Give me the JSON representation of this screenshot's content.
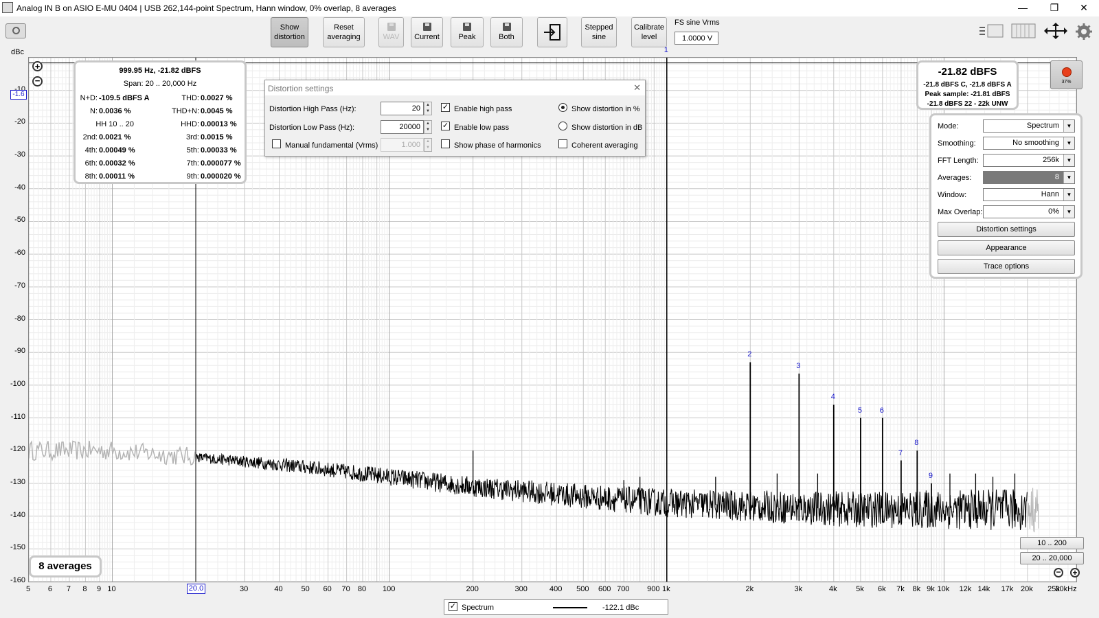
{
  "window": {
    "title": "Analog IN B on ASIO E-MU 0404 | USB 262,144-point Spectrum, Hann window, 0% overlap, 8 averages",
    "minimize": "—",
    "maximize": "❐",
    "close": "✕"
  },
  "toolbar": {
    "show_distortion": [
      "Show",
      "distortion"
    ],
    "reset_averaging": [
      "Reset",
      "averaging"
    ],
    "wav": "WAV",
    "current": "Current",
    "peak": "Peak",
    "both": "Both",
    "stepped_sine": [
      "Stepped",
      "sine"
    ],
    "calibrate_level": [
      "Calibrate",
      "level"
    ],
    "fs_sine_label": "FS sine Vrms",
    "fs_sine_value": "1.0000 V"
  },
  "yaxis": {
    "unit": "dBc",
    "cursor_value": "-1.6",
    "unit_select": "dBc",
    "ticks": [
      "-10",
      "-20",
      "-30",
      "-40",
      "-50",
      "-60",
      "-70",
      "-80",
      "-90",
      "-100",
      "-110",
      "-120",
      "-130",
      "-140",
      "-150",
      "-160"
    ]
  },
  "xaxis": {
    "ticks": [
      {
        "f": 5,
        "l": "5"
      },
      {
        "f": 6,
        "l": "6"
      },
      {
        "f": 7,
        "l": "7"
      },
      {
        "f": 8,
        "l": "8"
      },
      {
        "f": 9,
        "l": "9"
      },
      {
        "f": 10,
        "l": "10"
      },
      {
        "f": 30,
        "l": "30"
      },
      {
        "f": 40,
        "l": "40"
      },
      {
        "f": 50,
        "l": "50"
      },
      {
        "f": 60,
        "l": "60"
      },
      {
        "f": 70,
        "l": "70"
      },
      {
        "f": 80,
        "l": "80"
      },
      {
        "f": 100,
        "l": "100"
      },
      {
        "f": 200,
        "l": "200"
      },
      {
        "f": 300,
        "l": "300"
      },
      {
        "f": 400,
        "l": "400"
      },
      {
        "f": 500,
        "l": "500"
      },
      {
        "f": 600,
        "l": "600"
      },
      {
        "f": 700,
        "l": "700"
      },
      {
        "f": 900,
        "l": "900"
      },
      {
        "f": 1000,
        "l": "1k"
      },
      {
        "f": 2000,
        "l": "2k"
      },
      {
        "f": 3000,
        "l": "3k"
      },
      {
        "f": 4000,
        "l": "4k"
      },
      {
        "f": 5000,
        "l": "5k"
      },
      {
        "f": 6000,
        "l": "6k"
      },
      {
        "f": 7000,
        "l": "7k"
      },
      {
        "f": 8000,
        "l": "8k"
      },
      {
        "f": 9000,
        "l": "9k"
      },
      {
        "f": 10000,
        "l": "10k"
      },
      {
        "f": 12000,
        "l": "12k"
      },
      {
        "f": 14000,
        "l": "14k"
      },
      {
        "f": 17000,
        "l": "17k"
      },
      {
        "f": 20000,
        "l": "20k"
      },
      {
        "f": 25000,
        "l": "25k"
      },
      {
        "f": 30000,
        "l": "30kHz"
      }
    ],
    "cursor_label": "20.0"
  },
  "measurements": {
    "header": "999.95 Hz, -21.82 dBFS",
    "span": "Span: 20 .. 20,000 Hz",
    "rows": [
      {
        "l1": "N+D:",
        "v1": "-109.5 dBFS A",
        "l2": "THD:",
        "v2": "0.0027 %"
      },
      {
        "l1": "N:",
        "v1": "0.0036 %",
        "l2": "THD+N:",
        "v2": "0.0045 %"
      },
      {
        "l1": "HH 10 .. 20",
        "v1": "",
        "l2": "HHD:",
        "v2": "0.00013 %"
      },
      {
        "l1": "2nd:",
        "v1": "0.0021 %",
        "l2": "3rd:",
        "v2": "0.0015 %"
      },
      {
        "l1": "4th:",
        "v1": "0.00049 %",
        "l2": "5th:",
        "v2": "0.00033 %"
      },
      {
        "l1": "6th:",
        "v1": "0.00032 %",
        "l2": "7th:",
        "v2": "0.000077 %"
      },
      {
        "l1": "8th:",
        "v1": "0.00011 %",
        "l2": "9th:",
        "v2": "0.000020 %"
      }
    ]
  },
  "level_panel": {
    "main": "-21.82 dBFS",
    "line1": "-21.8 dBFS C, -21.8 dBFS A",
    "line2": "Peak sample: -21.81 dBFS",
    "line3": "-21.8 dBFS 22 - 22k UNW",
    "record_pct": "37%"
  },
  "distortion_dialog": {
    "title": "Distortion settings",
    "close": "✕",
    "hp_label": "Distortion High Pass (Hz):",
    "hp_value": "20",
    "lp_label": "Distortion Low Pass (Hz):",
    "lp_value": "20000",
    "manual_label": "Manual fundamental (Vrms)",
    "manual_value": "1.000",
    "enable_hp": "Enable high pass",
    "enable_lp": "Enable low pass",
    "show_phase": "Show phase of harmonics",
    "show_pct": "Show distortion in %",
    "show_db": "Show distortion in dB",
    "coherent": "Coherent averaging"
  },
  "settings_panel": {
    "rows": [
      {
        "label": "Mode:",
        "value": "Spectrum"
      },
      {
        "label": "Smoothing:",
        "value": "No  smoothing"
      },
      {
        "label": "FFT Length:",
        "value": "256k"
      },
      {
        "label": "Averages:",
        "value": "8"
      },
      {
        "label": "Window:",
        "value": "Hann"
      },
      {
        "label": "Max Overlap:",
        "value": "0%"
      }
    ],
    "distortion_settings": "Distortion settings",
    "appearance": "Appearance",
    "trace_options": "Trace options"
  },
  "averages_badge": "8 averages",
  "range_buttons": {
    "r1": "10 .. 200",
    "r2": "20 .. 20,000"
  },
  "legend": {
    "name": "Spectrum",
    "value": "-122.1 dBc"
  },
  "chart_data": {
    "type": "line",
    "xscale": "log",
    "xlim": [
      5,
      30000
    ],
    "ylim": [
      -160,
      0
    ],
    "ylabel": "dBc",
    "fundamental": {
      "label": "1",
      "f": 1000,
      "dbc": 0
    },
    "harmonics": [
      {
        "label": "2",
        "f": 2000,
        "dbc": -93
      },
      {
        "label": "3",
        "f": 3000,
        "dbc": -96.5
      },
      {
        "label": "4",
        "f": 4000,
        "dbc": -106
      },
      {
        "label": "5",
        "f": 5000,
        "dbc": -110
      },
      {
        "label": "6",
        "f": 6000,
        "dbc": -110
      },
      {
        "label": "7",
        "f": 7000,
        "dbc": -123
      },
      {
        "label": "8",
        "f": 8000,
        "dbc": -120
      },
      {
        "label": "9",
        "f": 9000,
        "dbc": -130
      }
    ],
    "spurs": [
      {
        "f": 200,
        "dbc": -120
      },
      {
        "f": 700,
        "dbc": -129
      },
      {
        "f": 800,
        "dbc": -128
      },
      {
        "f": 1500,
        "dbc": -128
      },
      {
        "f": 2500,
        "dbc": -127
      },
      {
        "f": 3500,
        "dbc": -127
      },
      {
        "f": 10500,
        "dbc": -127
      },
      {
        "f": 13000,
        "dbc": -127
      },
      {
        "f": 15000,
        "dbc": -128
      },
      {
        "f": 18000,
        "dbc": -127
      }
    ],
    "noise_floor": [
      {
        "f": 5,
        "dbc": -120
      },
      {
        "f": 10,
        "dbc": -120
      },
      {
        "f": 20,
        "dbc": -122
      },
      {
        "f": 50,
        "dbc": -125
      },
      {
        "f": 100,
        "dbc": -128
      },
      {
        "f": 200,
        "dbc": -131
      },
      {
        "f": 500,
        "dbc": -134
      },
      {
        "f": 1000,
        "dbc": -136
      },
      {
        "f": 2000,
        "dbc": -137
      },
      {
        "f": 5000,
        "dbc": -138
      },
      {
        "f": 10000,
        "dbc": -138
      },
      {
        "f": 20000,
        "dbc": -138
      },
      {
        "f": 22000,
        "dbc": -141
      }
    ],
    "colors": {
      "trace": "#000000",
      "out_of_band": "#b4b4b4",
      "harmonic_labels": "#1a1acc",
      "cursor": "#000000"
    }
  }
}
